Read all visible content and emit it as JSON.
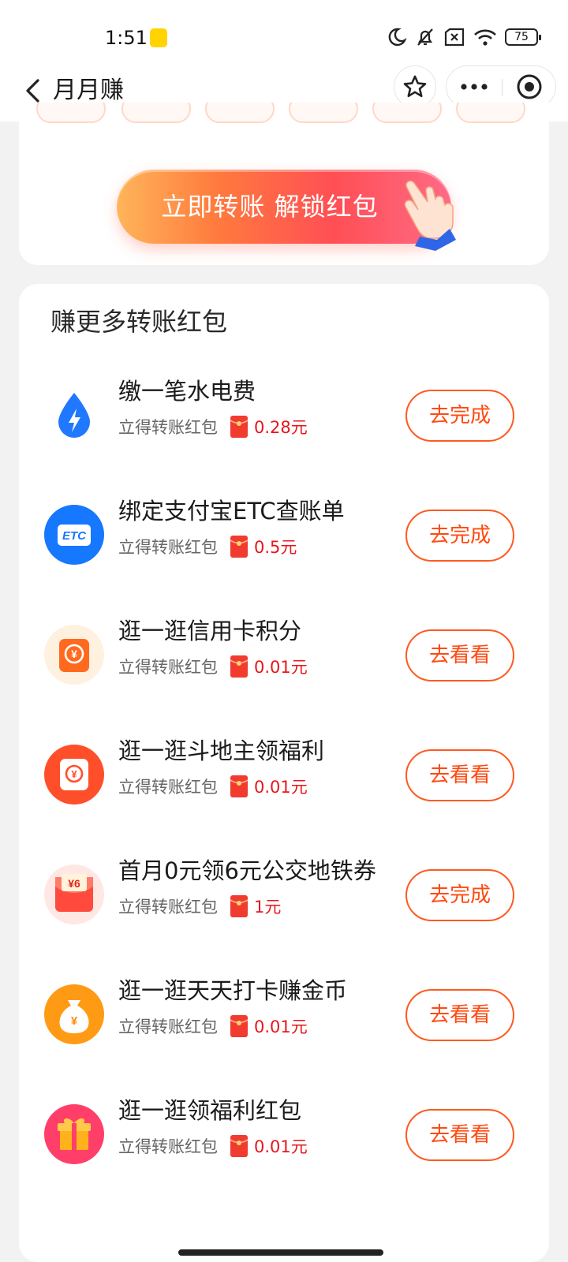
{
  "status_bar": {
    "time": "1:51",
    "battery": "75",
    "icons": [
      "app-notification-icon",
      "moon-icon",
      "bell-off-icon",
      "sim-x-icon",
      "wifi-icon",
      "battery-icon"
    ]
  },
  "header": {
    "title": "月月赚",
    "icons": [
      "back-arrow-icon",
      "star-icon",
      "more-icon",
      "mini-program-close-icon"
    ]
  },
  "promo": {
    "cta_label": "立即转账 解锁红包"
  },
  "section": {
    "title": "赚更多转账红包"
  },
  "colors": {
    "accent": "#ff4a12",
    "amount": "#e8161b",
    "cta_start": "#ffb55a",
    "cta_end": "#ff6a86"
  },
  "tasks": [
    {
      "title": "缴一笔水电费",
      "reward_label": "立得转账红包",
      "amount": "0.28元",
      "action": "去完成",
      "icon": "water-electric-icon"
    },
    {
      "title": "绑定支付宝ETC查账单",
      "reward_label": "立得转账红包",
      "amount": "0.5元",
      "action": "去完成",
      "icon": "etc-icon",
      "icon_text": "ETC"
    },
    {
      "title": "逛一逛信用卡积分",
      "reward_label": "立得转账红包",
      "amount": "0.01元",
      "action": "去看看",
      "icon": "credit-card-points-icon",
      "icon_text": "¥"
    },
    {
      "title": "逛一逛斗地主领福利",
      "reward_label": "立得转账红包",
      "amount": "0.01元",
      "action": "去看看",
      "icon": "card-game-icon",
      "icon_text": "¥"
    },
    {
      "title": "首月0元领6元公交地铁券",
      "reward_label": "立得转账红包",
      "amount": "1元",
      "action": "去完成",
      "icon": "transit-coupon-icon",
      "icon_text": "¥6"
    },
    {
      "title": "逛一逛天天打卡赚金币",
      "reward_label": "立得转账红包",
      "amount": "0.01元",
      "action": "去看看",
      "icon": "money-bag-icon",
      "icon_text": "¥"
    },
    {
      "title": "逛一逛领福利红包",
      "reward_label": "立得转账红包",
      "amount": "0.01元",
      "action": "去看看",
      "icon": "gift-icon"
    }
  ]
}
